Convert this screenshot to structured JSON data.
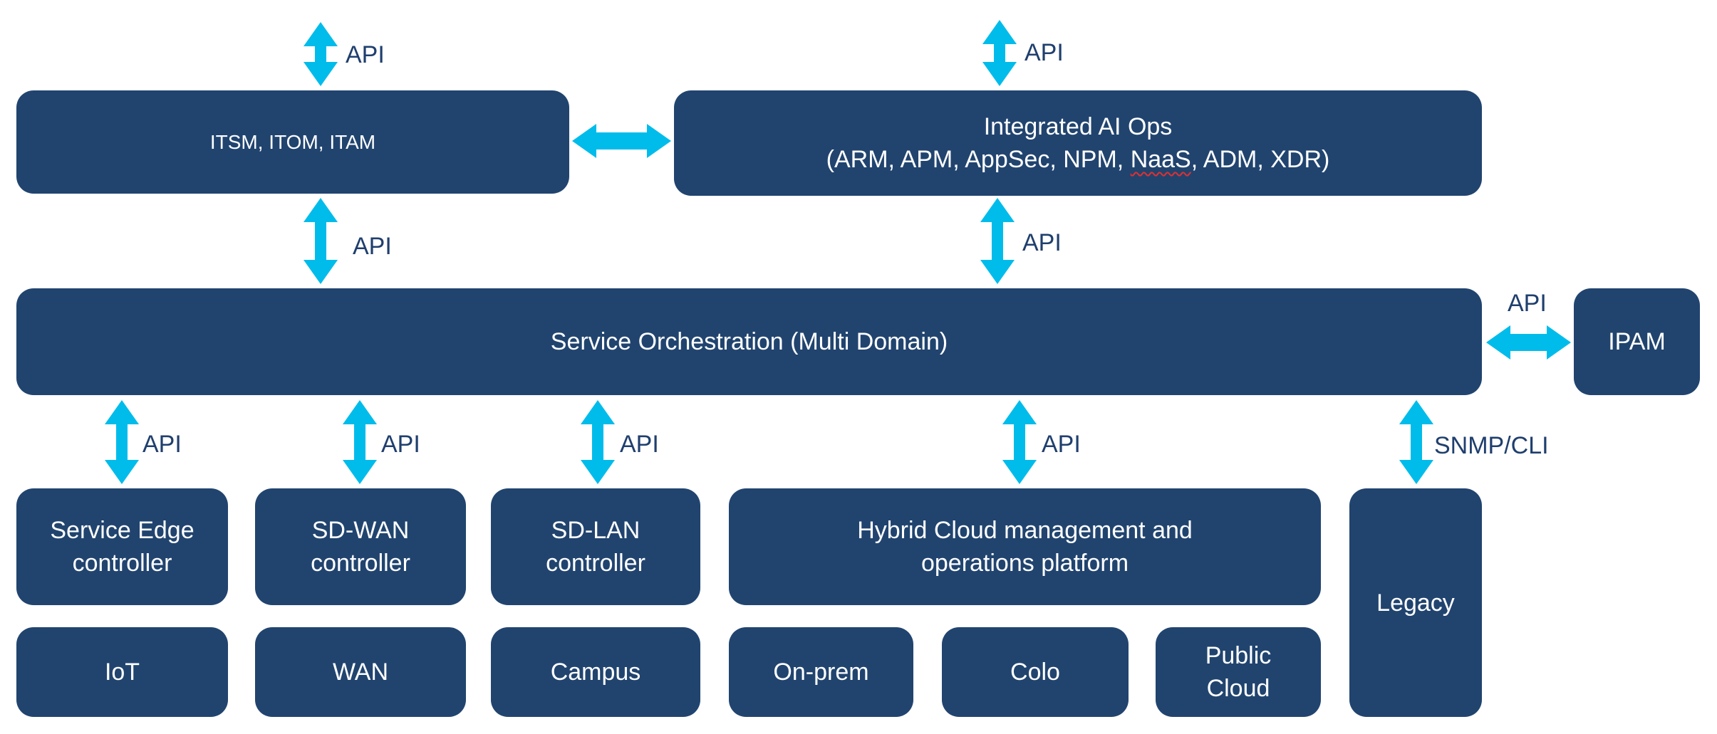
{
  "colors": {
    "box": "#21446f",
    "arrow": "#00bceb",
    "label": "#1f3f6e",
    "box_text": "#ffffff"
  },
  "boxes": {
    "itsm": "ITSM, ITOM, ITAM",
    "aiops_line1": "Integrated AI Ops",
    "aiops_line2_pre": "(ARM, APM, AppSec, NPM, ",
    "aiops_line2_naas": "NaaS",
    "aiops_line2_post": ", ADM, XDR)",
    "orchestration": "Service Orchestration (Multi Domain)",
    "ipam": "IPAM",
    "service_edge": [
      "Service Edge",
      "controller"
    ],
    "sdwan": [
      "SD-WAN",
      "controller"
    ],
    "sdlan": [
      "SD-LAN",
      "controller"
    ],
    "hybrid": [
      "Hybrid Cloud management and",
      "operations platform"
    ],
    "legacy": "Legacy",
    "iot": "IoT",
    "wan": "WAN",
    "campus": "Campus",
    "onprem": "On-prem",
    "colo": "Colo",
    "public_cloud": [
      "Public",
      "Cloud"
    ]
  },
  "labels": {
    "api": "API",
    "snmp_cli": "SNMP/CLI"
  }
}
